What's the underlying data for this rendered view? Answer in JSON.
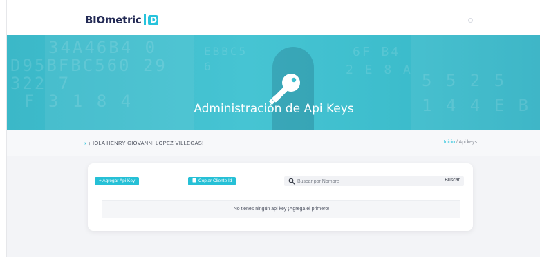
{
  "brand": {
    "name": "BIOmetric",
    "badge": "D"
  },
  "hero": {
    "title": "Administración de Api Keys",
    "deco_lines": [
      "34A46B4 0",
      "D95BFBC560 29",
      "322 7",
      "F 3 1 8 4",
      "EBBC5",
      "6",
      "6F B4",
      "2 E 8 A",
      "5 5 2 5",
      "1 4 4 E B 1 2"
    ]
  },
  "greeting": {
    "text": "¡HOLA HENRY GIOVANNI LOPEZ VILLEGAS!"
  },
  "breadcrumb": {
    "home": "Inicio",
    "separator": "/",
    "current": "Api keys"
  },
  "actions": {
    "add_label": "+ Agregar Api Key",
    "copy_label": "Copiar Cliente Id"
  },
  "search": {
    "placeholder": "Buscar por Nombre",
    "value": "",
    "button_label": "Buscar"
  },
  "empty_state": {
    "message": "No tienes ningún api key ¡Agrega el primero!"
  },
  "colors": {
    "accent": "#26c0d6",
    "hero": "#3ebecd",
    "brand_text": "#232a55"
  },
  "icons": [
    "key-icon",
    "search-icon",
    "clipboard-icon",
    "chevron-right-icon",
    "menu-icon"
  ]
}
